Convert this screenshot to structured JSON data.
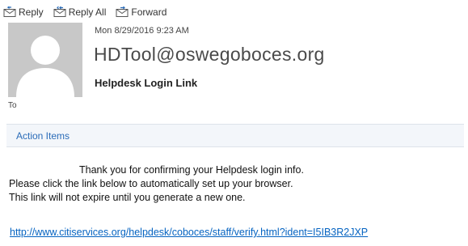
{
  "toolbar": {
    "reply_label": "Reply",
    "reply_all_label": "Reply All",
    "forward_label": "Forward",
    "reply_icon": "reply-icon",
    "reply_all_icon": "reply-all-icon",
    "forward_icon": "forward-icon"
  },
  "message": {
    "date": "Mon 8/29/2016 9:23 AM",
    "sender": "HDTool@oswegoboces.org",
    "subject": "Helpdesk Login Link",
    "to_label": "To",
    "avatar_icon": "person-silhouette-icon"
  },
  "action_bar": {
    "label": "Action Items"
  },
  "body": {
    "line1": "Thank you for confirming your Helpdesk login info.",
    "line2": "Please click the link below to automatically set up your browser.",
    "line3": "This link will not expire until you generate a new one.",
    "link": "http://www.citiservices.org/helpdesk/coboces/staff/verify.html?ident=I5IB3R2JXP"
  },
  "colors": {
    "accent": "#2b6cb8",
    "link": "#0563c1",
    "action_bar_bg": "#f3f6fa",
    "avatar_bg": "#c8c8c8"
  }
}
